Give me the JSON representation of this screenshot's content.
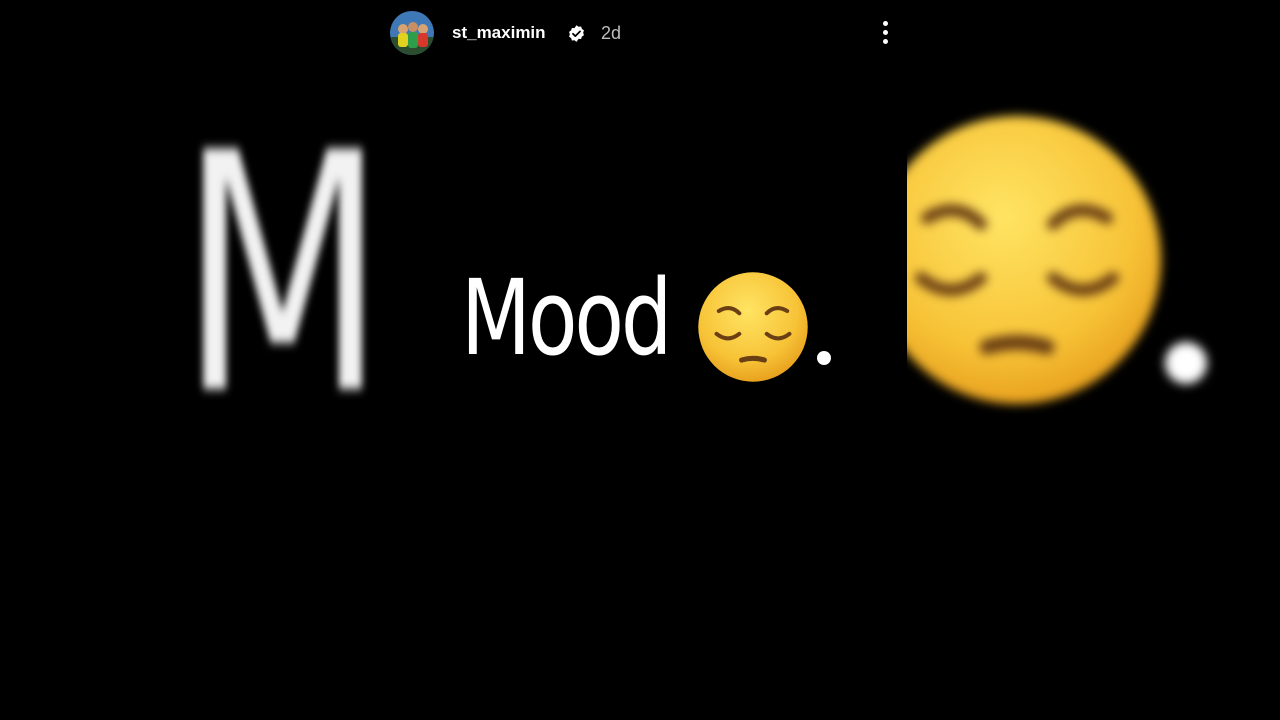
{
  "story": {
    "username": "st_maximin",
    "time_ago": "2d",
    "verified": true,
    "text": "Mood",
    "emoji": "pensive-face-emoji",
    "trailing_punctuation": "."
  },
  "icons": {
    "verified": "verified-badge-icon",
    "more": "more-vertical-icon"
  },
  "colors": {
    "background": "#000000",
    "text": "#ffffff",
    "timestamp": "#bdbdbd",
    "emoji_yellow": "#f7c337"
  }
}
